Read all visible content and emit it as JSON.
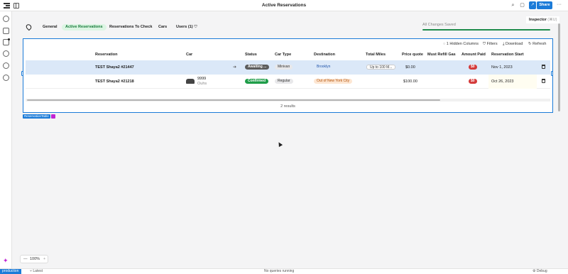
{
  "window": {
    "title": "Active Reservations"
  },
  "header": {
    "share_label": "Share",
    "link_icon": "link-icon",
    "more_icon": "more-icon"
  },
  "inspector": {
    "label": "Inspector",
    "shortcut": "(⌘U)"
  },
  "app_nav": {
    "tabs": [
      {
        "label": "General"
      },
      {
        "label": "Active Reservations",
        "active": true
      },
      {
        "label": "Reservations To Check"
      },
      {
        "label": "Cars"
      },
      {
        "label": "Users (1)"
      }
    ],
    "save_status": "All Changes Saved"
  },
  "table": {
    "toolbar": {
      "hidden_columns": "1 Hidden Columns",
      "filters": "Filters",
      "download": "Download",
      "refresh": "Refresh"
    },
    "columns": [
      "Reservation",
      "Car",
      "Status",
      "Car Type",
      "Destination",
      "Total Miles",
      "Price quote",
      "Must Refill Gas",
      "Amount Paid",
      "Reservation Start"
    ],
    "rows": [
      {
        "reservation": "TEST Shaya2 #21447",
        "car_name": "",
        "car_sub": "",
        "status": "Awaiting ...",
        "car_type": "Minivan",
        "destination": "Brooklyn",
        "total_miles": "Up to 100 M...",
        "price_quote": "$0.00",
        "amount_paid": "$0",
        "reservation_start": "Nov 1, 2023"
      },
      {
        "reservation": "TEST Shaya2 #21218",
        "car_name": "9999",
        "car_sub": "Ouhs",
        "status": "Confirmed",
        "car_type": "Regular",
        "destination": "Out of New York City",
        "total_miles": "",
        "price_quote": "$100.00",
        "amount_paid": "$0",
        "reservation_start": "Oct 26, 2023"
      }
    ],
    "results": "2 results",
    "component_tag": "ReservationTable"
  },
  "zoom": {
    "value": "100%",
    "minus": "—",
    "plus": "+"
  },
  "statusbar": {
    "environment": "production",
    "branch": "Latest",
    "queries": "No queries running",
    "debug": "Debug"
  },
  "colors": {
    "accent": "#1b7bd8",
    "success": "#1f9d49",
    "danger": "#d43a3a"
  }
}
